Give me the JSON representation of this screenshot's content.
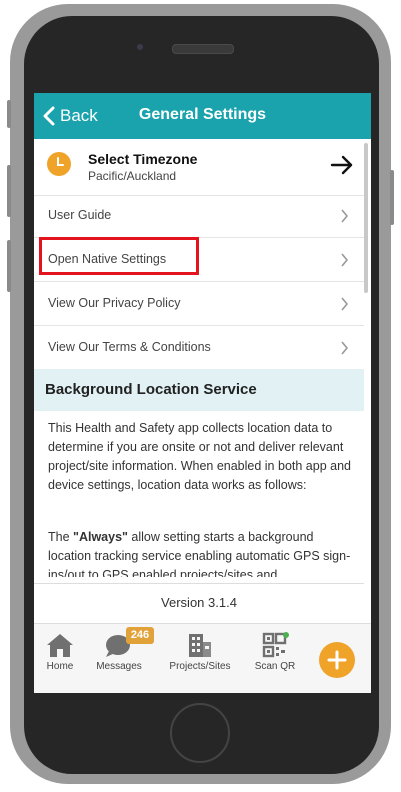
{
  "header": {
    "back_label": "Back",
    "title": "General Settings"
  },
  "timezone": {
    "title": "Select Timezone",
    "value": "Pacific/Auckland"
  },
  "menu": [
    {
      "label": "User Guide"
    },
    {
      "label": "Open Native Settings"
    },
    {
      "label": "View Our Privacy Policy"
    },
    {
      "label": "View Our Terms & Conditions"
    }
  ],
  "section": {
    "title": "Background Location Service",
    "paragraph1": "This Health and Safety app collects location data to determine if you are onsite or not and deliver relevant project/site information. When enabled in both app and device settings, location data works as follows:",
    "paragraph2_prefix": "The ",
    "paragraph2_bold": "\"Always\"",
    "paragraph2_rest": " allow setting starts a background location tracking service enabling automatic GPS sign-ins/out to GPS enabled projects/sites and"
  },
  "version": "Version 3.1.4",
  "tabs": [
    {
      "label": "Home"
    },
    {
      "label": "Messages",
      "badge": "246"
    },
    {
      "label": "Projects/Sites"
    },
    {
      "label": "Scan QR"
    }
  ],
  "colors": {
    "header": "#1aa3ad",
    "accent": "#f0a329",
    "highlight": "#e3141e",
    "section_bg": "#e2f2f4"
  }
}
